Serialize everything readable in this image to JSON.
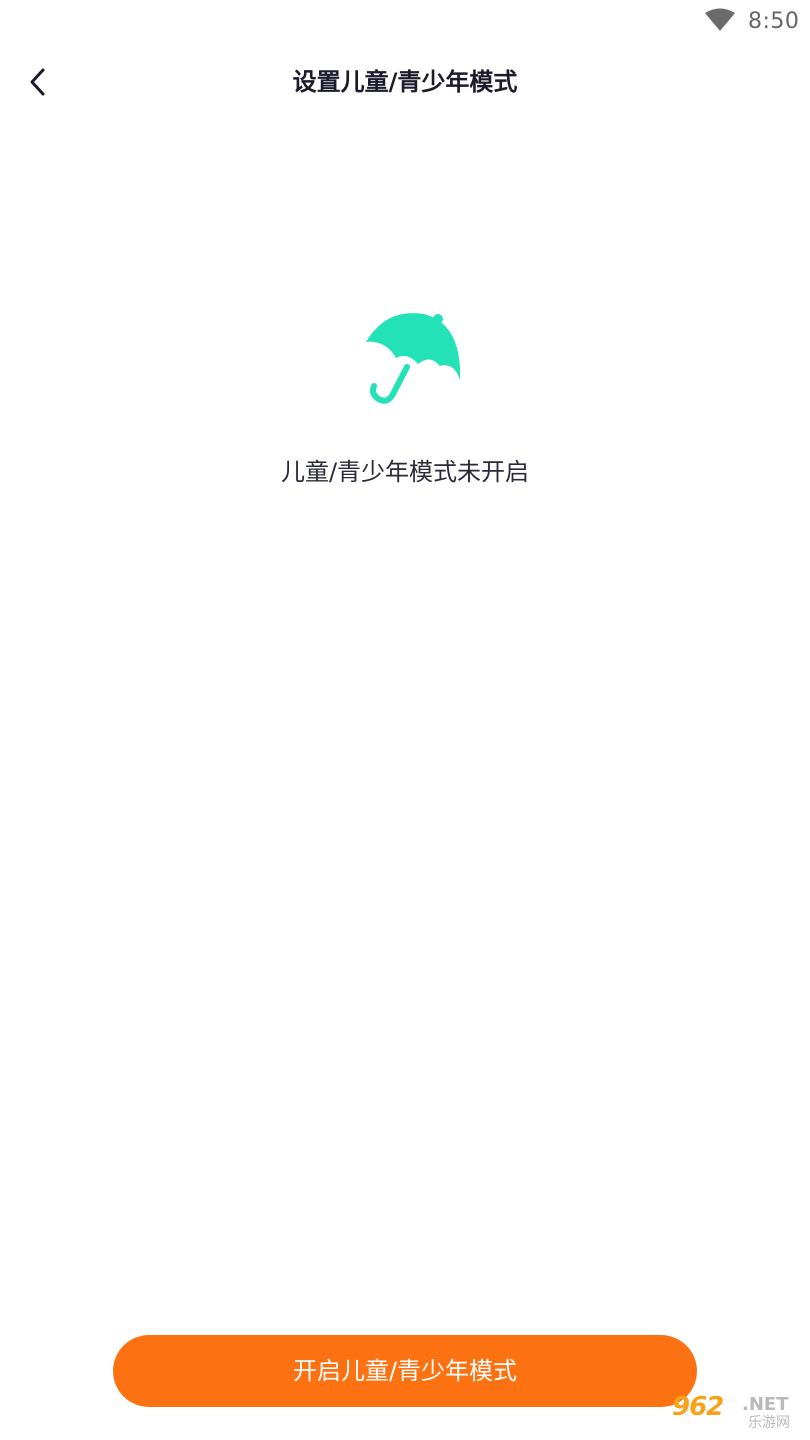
{
  "status_bar": {
    "time": "8:50",
    "icons": [
      "wifi-icon"
    ]
  },
  "nav": {
    "back_icon": "chevron-left-icon",
    "title": "设置儿童/青少年模式"
  },
  "main": {
    "icon": "umbrella-icon",
    "status_text": "儿童/青少年模式未开启"
  },
  "footer": {
    "enable_label": "开启儿童/青少年模式"
  },
  "watermark": {
    "number": "962",
    "net": ".NET",
    "cn": "乐游网"
  },
  "colors": {
    "accent": "#fc7212",
    "umbrella": "#23e2b8",
    "text": "#1b1b2b",
    "status_gray": "#666666"
  }
}
